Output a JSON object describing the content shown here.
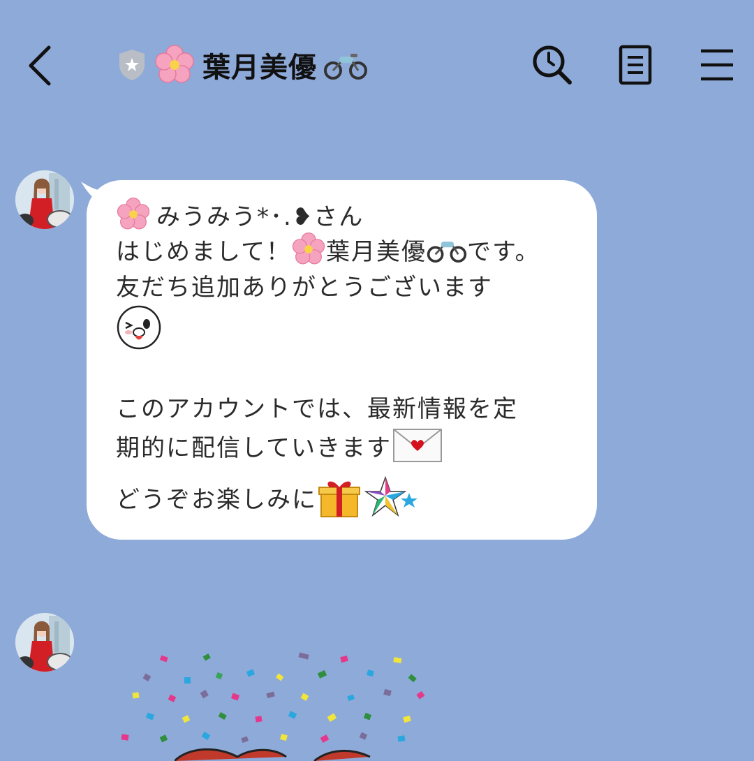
{
  "header": {
    "back_icon": "chevron-left-icon",
    "official_badge_icon": "shield-star-icon",
    "title": "葉月美優",
    "title_prefix_icon": "cherry-blossom-icon",
    "title_suffix_icon": "motorcycle-icon",
    "actions": [
      "search-icon",
      "notes-icon",
      "menu-icon"
    ]
  },
  "chat": {
    "message": {
      "line1_text": "みうみう*･.❥さん",
      "line2_part1": "はじめまして！",
      "line2_name": "葉月美優",
      "line2_part2": "です。",
      "line3": "友だち追加ありがとうございます",
      "line5": "このアカウントでは、最新情報を定",
      "line6": "期的に配信していきます",
      "line7": "どうぞお楽しみに"
    },
    "emoji_icons": [
      "cherry-blossom-icon",
      "motorcycle-icon",
      "wink-face-icon",
      "love-letter-icon",
      "gift-icon",
      "star-icon"
    ]
  },
  "colors": {
    "background": "#8eaad8",
    "bubble": "#ffffff",
    "text": "#2b2b2b"
  }
}
